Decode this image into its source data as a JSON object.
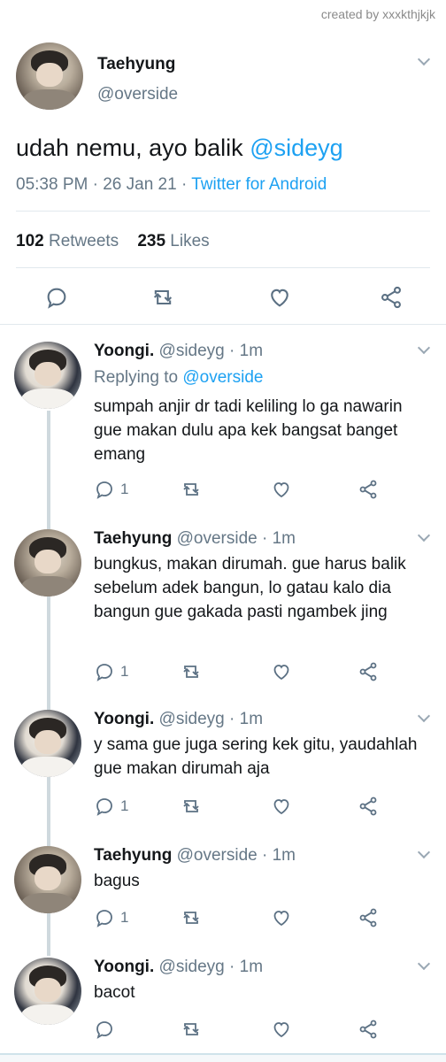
{
  "watermark": "created by xxxkthjkjk",
  "colors": {
    "link": "#1da1f2",
    "muted": "#657786",
    "text": "#14171a",
    "divider": "#e1e8ed"
  },
  "main_tweet": {
    "name": "Taehyung",
    "handle": "@overside",
    "text": "udah nemu, ayo balik ",
    "mention": "@sideyg",
    "time": "05:38 PM · 26 Jan 21 · ",
    "source": "Twitter for Android",
    "retweets_count": "102",
    "retweets_label": "Retweets",
    "likes_count": "235",
    "likes_label": "Likes",
    "icons": [
      "reply-icon",
      "retweet-icon",
      "like-icon",
      "share-icon"
    ]
  },
  "replies": [
    {
      "name": "Yoongi.",
      "meta": "@sideyg · 1m",
      "replying_prefix": "Replying to ",
      "replying_mention": "@overside",
      "body": "sumpah anjir dr tadi keliling lo ga nawarin gue makan dulu apa kek bangsat banget emang",
      "reply_count": "1"
    },
    {
      "name": "Taehyung",
      "meta": "@overside · 1m",
      "body": "bungkus, makan dirumah. gue harus balik sebelum adek bangun, lo gatau kalo dia bangun gue gakada pasti ngambek jing",
      "reply_count": "1"
    },
    {
      "name": "Yoongi.",
      "meta": "@sideyg · 1m",
      "body": "y sama gue juga sering kek gitu, yaudahlah gue makan dirumah aja",
      "reply_count": "1"
    },
    {
      "name": "Taehyung",
      "meta": "@overside · 1m",
      "body": "bagus",
      "reply_count": "1"
    },
    {
      "name": "Yoongi.",
      "meta": "@sideyg · 1m",
      "body": "bacot",
      "reply_count": ""
    }
  ]
}
